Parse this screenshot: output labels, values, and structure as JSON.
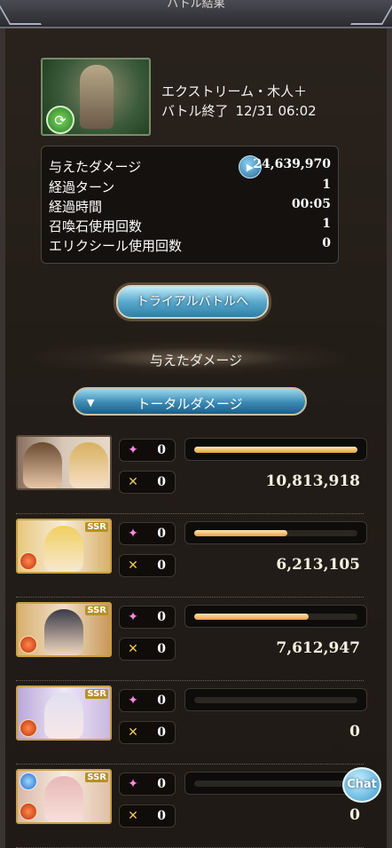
{
  "header": {
    "title": "バトル結果"
  },
  "quest": {
    "name": "エクストリーム・木人＋",
    "status": "バトル終了",
    "datetime": "12/31 06:02"
  },
  "stats": [
    {
      "label": "与えたダメージ",
      "value": "24,639,970"
    },
    {
      "label": "経過ターン",
      "value": "1"
    },
    {
      "label": "経過時間",
      "value": "00:05"
    },
    {
      "label": "召喚石使用回数",
      "value": "1"
    },
    {
      "label": "エリクシール使用回数",
      "value": "0"
    }
  ],
  "trial_button": "トライアルバトルへ",
  "damage_section": {
    "title": "与えたダメージ",
    "dropdown": "トータルダメージ"
  },
  "characters": [
    {
      "ssr": "",
      "skill_count": "0",
      "ougi_count": "0",
      "damage": "10,813,918",
      "ratio": 1.0
    },
    {
      "ssr": "SSR",
      "skill_count": "0",
      "ougi_count": "0",
      "damage": "6,213,105",
      "ratio": 0.57
    },
    {
      "ssr": "SSR",
      "skill_count": "0",
      "ougi_count": "0",
      "damage": "7,612,947",
      "ratio": 0.7
    },
    {
      "ssr": "SSR",
      "skill_count": "0",
      "ougi_count": "0",
      "damage": "0",
      "ratio": 0
    },
    {
      "ssr": "SSR",
      "skill_count": "0",
      "ougi_count": "0",
      "damage": "0",
      "ratio": 0
    }
  ],
  "chat_button": "Chat",
  "colors": {
    "accent_blue": "#3a8ab4",
    "bar_gold": "#e8a040"
  }
}
